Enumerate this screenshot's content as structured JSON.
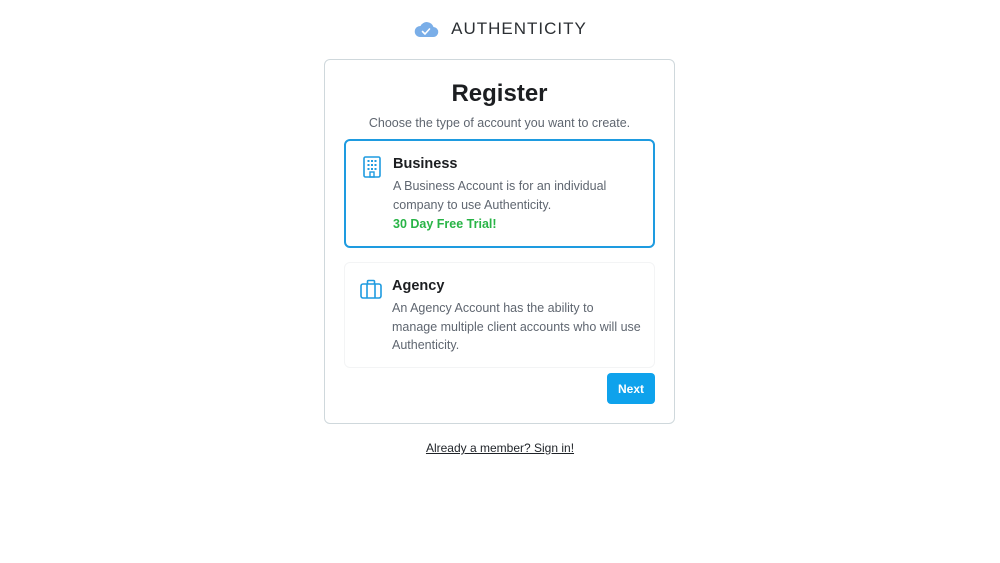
{
  "brand": {
    "name": "AUTHENTICITY",
    "icon": "cloud-check-icon",
    "icon_color": "#7aaee8"
  },
  "card": {
    "title": "Register",
    "subtitle": "Choose the type of account you want to create."
  },
  "options": [
    {
      "title": "Business",
      "icon": "building-icon",
      "description": "A Business Account is for an individual company to use Authenticity.",
      "trial": "30 Day Free Trial!",
      "selected": true
    },
    {
      "title": "Agency",
      "icon": "briefcase-icon",
      "description": "An Agency Account has the ability to manage multiple client accounts who will use Authenticity.",
      "selected": false
    }
  ],
  "actions": {
    "next_label": "Next"
  },
  "footer": {
    "signin_link": "Already a member? Sign in!"
  },
  "colors": {
    "accent": "#1e9be0",
    "button": "#0ea2ec",
    "trial": "#28b446"
  }
}
